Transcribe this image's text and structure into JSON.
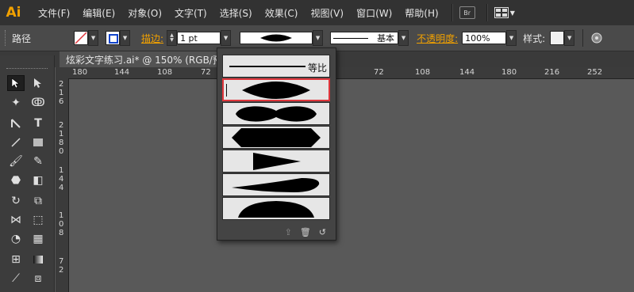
{
  "app": {
    "logo": "Ai"
  },
  "menu": {
    "items": [
      "文件(F)",
      "编辑(E)",
      "对象(O)",
      "文字(T)",
      "选择(S)",
      "效果(C)",
      "视图(V)",
      "窗口(W)",
      "帮助(H)"
    ],
    "bridge_label": "Br"
  },
  "control": {
    "object_type": "路径",
    "stroke_label": "描边:",
    "stroke_weight": "1 pt",
    "profile_label": "基本",
    "opacity_label": "不透明度:",
    "opacity_value": "100%",
    "style_label": "样式:"
  },
  "document": {
    "tab_title": "炫彩文字练习.ai* @ 150% (RGB/预"
  },
  "rulers": {
    "horizontal": [
      "180",
      "144",
      "108",
      "72",
      "72",
      "108",
      "144",
      "180",
      "216",
      "252"
    ],
    "vertical": [
      "2",
      "1",
      "6",
      "2",
      "1",
      "8",
      "0",
      "1",
      "4",
      "4",
      "1",
      "0",
      "8",
      "7",
      "2"
    ]
  },
  "width_profile_popup": {
    "equal_label": "等比",
    "selected_index": 1
  },
  "colors": {
    "accent_orange": "#f2a100",
    "highlight_red": "#e0353b",
    "menubar_bg": "#323232",
    "canvas_bg": "#595959"
  }
}
